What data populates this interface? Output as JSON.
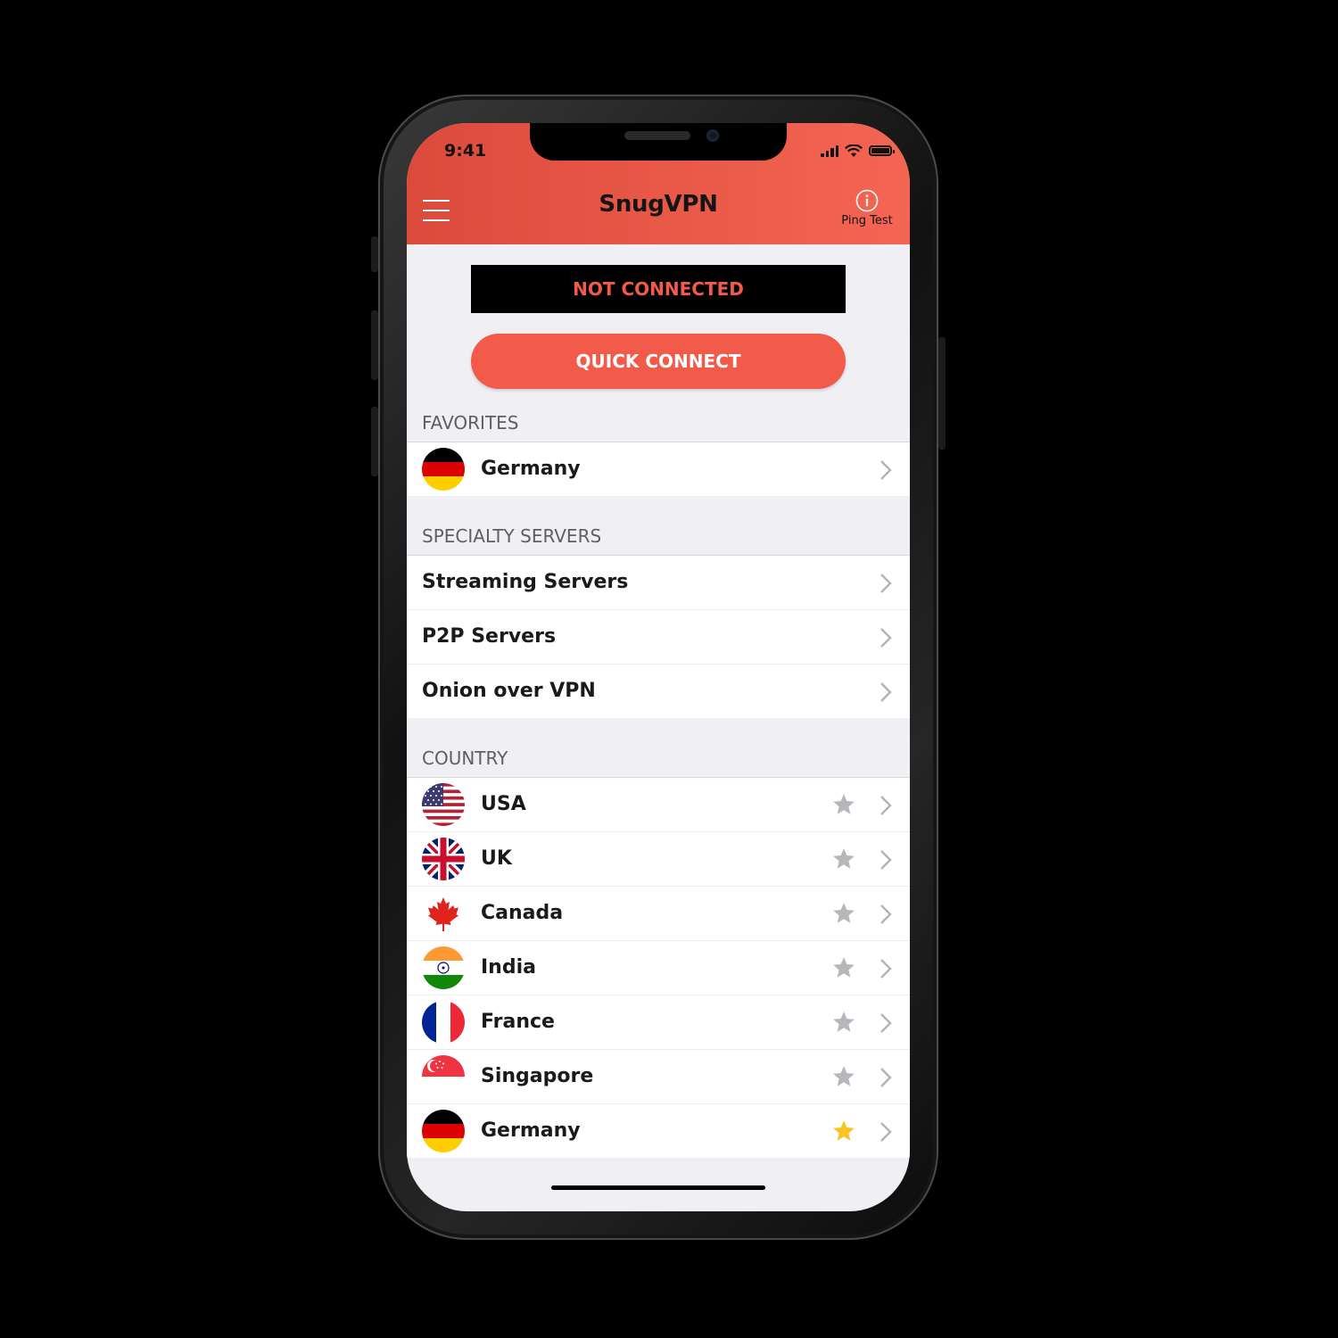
{
  "status_bar": {
    "time": "9:41"
  },
  "header": {
    "title": "SnugVPN",
    "ping_label": "Ping Test"
  },
  "connection": {
    "status": "NOT CONNECTED",
    "quick_connect_label": "QUICK CONNECT"
  },
  "favorites": {
    "label": "FAVORITES",
    "items": [
      {
        "name": "Germany",
        "flag": "germany-flag-icon"
      }
    ]
  },
  "specialty": {
    "label": "SPECIALTY SERVERS",
    "items": [
      {
        "name": "Streaming Servers"
      },
      {
        "name": "P2P Servers"
      },
      {
        "name": "Onion over VPN"
      }
    ]
  },
  "country": {
    "label": "COUNTRY",
    "items": [
      {
        "name": "USA",
        "flag": "usa-flag-icon",
        "favorite": false
      },
      {
        "name": "UK",
        "flag": "uk-flag-icon",
        "favorite": false
      },
      {
        "name": "Canada",
        "flag": "canada-flag-icon",
        "favorite": false
      },
      {
        "name": "India",
        "flag": "india-flag-icon",
        "favorite": false
      },
      {
        "name": "France",
        "flag": "france-flag-icon",
        "favorite": false
      },
      {
        "name": "Singapore",
        "flag": "singapore-flag-icon",
        "favorite": false
      },
      {
        "name": "Germany",
        "flag": "germany-flag-icon",
        "favorite": true
      }
    ]
  },
  "colors": {
    "accent": "#f25a49",
    "header_start": "#dc4a3b",
    "header_end": "#f46553",
    "star_on": "#f7c325",
    "star_off": "#b7b7bb"
  }
}
